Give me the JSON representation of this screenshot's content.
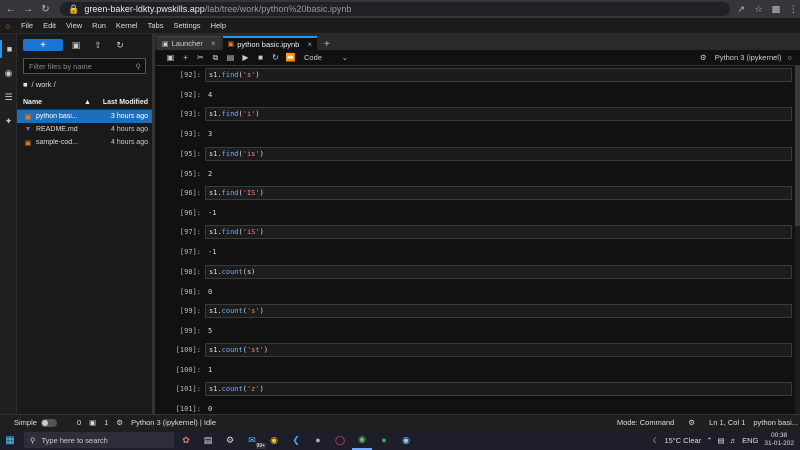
{
  "browser": {
    "url_host": "green-baker-ldkty.pwskills.app",
    "url_path": "/lab/tree/work/python%20basic.ipynb"
  },
  "menu": [
    "File",
    "Edit",
    "View",
    "Run",
    "Kernel",
    "Tabs",
    "Settings",
    "Help"
  ],
  "filebrowser": {
    "new_label": "+",
    "filter_placeholder": "Filter files by name",
    "breadcrumb": "/ work /",
    "col_name": "Name",
    "col_modified": "Last Modified",
    "files": [
      {
        "name": "python basi...",
        "modified": "3 hours ago",
        "icon": "notebook-icon",
        "selected": true
      },
      {
        "name": "README.md",
        "modified": "4 hours ago",
        "icon": "markdown-icon",
        "selected": false
      },
      {
        "name": "sample-cod...",
        "modified": "4 hours ago",
        "icon": "notebook-icon",
        "selected": false
      }
    ]
  },
  "tabs": [
    {
      "label": "Launcher",
      "active": false
    },
    {
      "label": "python basic.ipynb",
      "active": true
    }
  ],
  "toolbar": {
    "cell_type": "Code",
    "kernel": "Python 3 (ipykernel)"
  },
  "cells": [
    {
      "in": "[92]:",
      "code_prefix": "s1.",
      "fn": "find",
      "arg": "'s'",
      "is_str": true,
      "out": "[92]:",
      "result": "4"
    },
    {
      "in": "[93]:",
      "code_prefix": "s1.",
      "fn": "find",
      "arg": "'i'",
      "is_str": true,
      "out": "[93]:",
      "result": "3"
    },
    {
      "in": "[95]:",
      "code_prefix": "s1.",
      "fn": "find",
      "arg": "'is'",
      "is_str": true,
      "out": "[95]:",
      "result": "2"
    },
    {
      "in": "[96]:",
      "code_prefix": "s1.",
      "fn": "find",
      "arg": "'IS'",
      "is_str": true,
      "out": "[96]:",
      "result": "-1"
    },
    {
      "in": "[97]:",
      "code_prefix": "s1.",
      "fn": "find",
      "arg": "'iS'",
      "is_str": true,
      "out": "[97]:",
      "result": "-1"
    },
    {
      "in": "[98]:",
      "code_prefix": "s1.",
      "fn": "count",
      "arg": "s",
      "is_str": false,
      "out": "[98]:",
      "result": "0"
    },
    {
      "in": "[99]:",
      "code_prefix": "s1.",
      "fn": "count",
      "arg": "'s'",
      "is_str": true,
      "out": "[99]:",
      "result": "5"
    },
    {
      "in": "[100]:",
      "code_prefix": "s1.",
      "fn": "count",
      "arg": "'st'",
      "is_str": true,
      "out": "[100]:",
      "result": "1"
    },
    {
      "in": "[101]:",
      "code_prefix": "s1.",
      "fn": "count",
      "arg": "'z'",
      "is_str": true,
      "out": "[101]:",
      "result": "0"
    }
  ],
  "status": {
    "mode_label": "Simple",
    "count_a": "0",
    "count_b": "1",
    "kernel_status": "Python 3 (ipykernel) | Idle",
    "command_mode": "Mode: Command",
    "cursor_pos": "Ln 1, Col 1",
    "file_name": "python basi..."
  },
  "taskbar": {
    "search_placeholder": "Type here to search",
    "badge": "99+",
    "weather": "15°C  Clear",
    "lang": "ENG",
    "time": "00:38",
    "date": "31-01-202"
  }
}
